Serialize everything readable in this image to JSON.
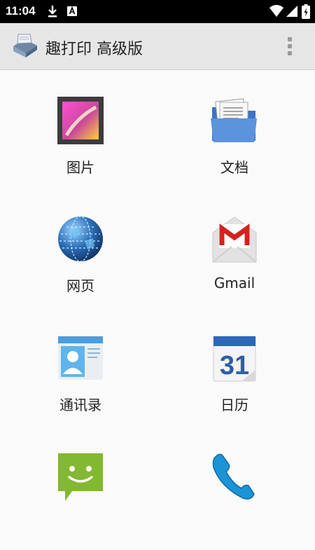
{
  "status_bar": {
    "time": "11:04",
    "icons": [
      "download-icon",
      "notification-a-icon",
      "wifi-icon",
      "signal-icon",
      "battery-icon"
    ]
  },
  "app_bar": {
    "title": "趣打印 高级版",
    "logo_icon": "printer-icon",
    "menu_icon": "overflow-menu-icon"
  },
  "grid": {
    "items": [
      {
        "label": "图片",
        "icon": "gallery-icon"
      },
      {
        "label": "文档",
        "icon": "folder-documents-icon"
      },
      {
        "label": "网页",
        "icon": "globe-icon"
      },
      {
        "label": "Gmail",
        "icon": "gmail-icon"
      },
      {
        "label": "通讯录",
        "icon": "contacts-icon"
      },
      {
        "label": "日历",
        "icon": "calendar-icon"
      },
      {
        "label": "",
        "icon": "messaging-icon"
      },
      {
        "label": "",
        "icon": "phone-icon"
      }
    ],
    "calendar_day": "31"
  },
  "colors": {
    "status_bar": "#000000",
    "app_bar": "#e6e6e6",
    "background": "#fafafa"
  }
}
